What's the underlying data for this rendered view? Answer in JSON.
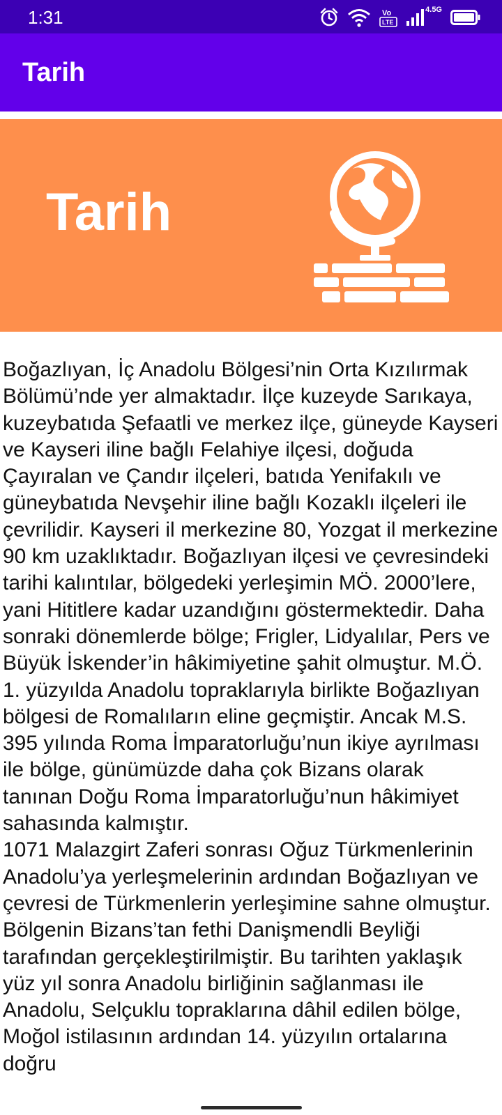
{
  "status_bar": {
    "time": "1:31",
    "network_label": "4.5G",
    "volte_label": "Vo LTE",
    "icons": [
      "alarm-icon",
      "wifi-icon",
      "volte-icon",
      "signal-icon",
      "battery-icon"
    ],
    "background": "#3c00b4"
  },
  "app_bar": {
    "title": "Tarih",
    "background": "#6200ea"
  },
  "banner": {
    "title": "Tarih",
    "icon": "globe-books-icon",
    "background": "#fe8f4c"
  },
  "content": {
    "paragraphs": [
      "Boğazlıyan, İç Anadolu Bölgesi’nin Orta Kızılırmak Bölümü’nde yer almaktadır.  İlçe kuzeyde Sarıkaya, kuzeybatıda Şefaatli ve merkez ilçe, güneyde Kayseri ve Kayseri iline bağlı Felahiye ilçesi, doğuda Çayıralan ve Çandır ilçeleri, batıda Yenifakılı ve güneybatıda Nevşehir iline bağlı Kozaklı ilçeleri ile çevrilidir. Kayseri il merkezine 80, Yozgat il merkezine  90 km uzaklıktadır. Boğazlıyan ilçesi ve çevresindeki tarihi kalıntılar, bölgedeki yerleşimin MÖ. 2000’lere, yani Hititlere kadar uzandığını göstermektedir. Daha sonraki dönemlerde bölge; Frigler, Lidyalılar, Pers ve Büyük İskender’in hâkimiyetine şahit olmuştur. M.Ö. 1. yüzyılda Anadolu topraklarıyla birlikte Boğazlıyan bölgesi de Romalıların eline geçmiştir. Ancak M.S. 395 yılında Roma İmparatorluğu’nun ikiye ayrılması ile bölge, günümüzde daha çok Bizans olarak tanınan Doğu Roma İmparatorluğu’nun hâkimiyet sahasında kalmıştır.",
      "1071 Malazgirt Zaferi sonrası Oğuz Türkmenlerinin Anadolu’ya yerleşmelerinin ardından Boğazlıyan ve çevresi de Türkmenlerin yerleşimine sahne olmuştur. Bölgenin Bizans’tan fethi Danişmendli Beyliği tarafından gerçekleştirilmiştir. Bu tarihten yaklaşık yüz yıl sonra Anadolu birliğinin sağlanması ile Anadolu, Selçuklu topraklarına dâhil edilen bölge, Moğol istilasının ardından 14. yüzyılın ortalarına doğru"
    ]
  }
}
